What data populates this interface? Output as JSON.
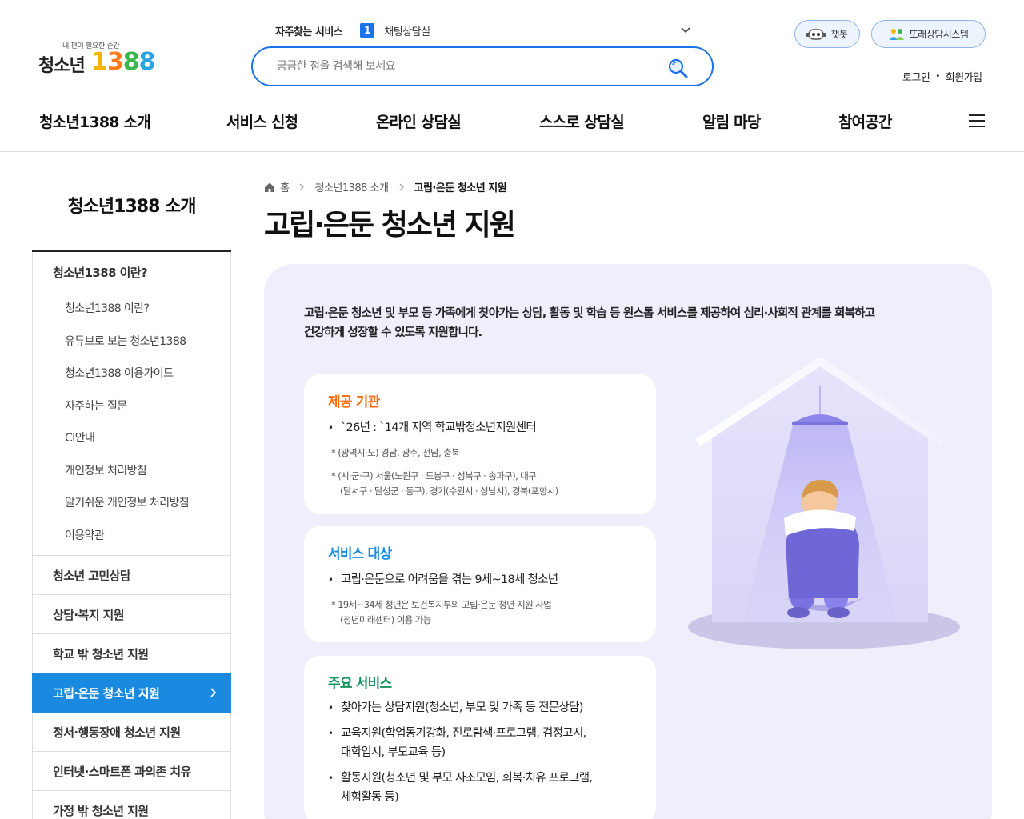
{
  "header": {
    "logo": {
      "tagline": "내 편이 필요한 순간",
      "name": "청소년",
      "number": "1388"
    },
    "favorites": {
      "label": "자주찾는 서비스",
      "rank": "1",
      "item": "채팅상담실"
    },
    "search": {
      "placeholder": "궁금한 점을 검색해 보세요"
    },
    "buttons": {
      "chatbot": "챗봇",
      "peer": "또래상담시스템"
    },
    "auth": {
      "login": "로그인",
      "separator": "•",
      "join": "회원가입"
    },
    "gnb": [
      "청소년1388 소개",
      "서비스 신청",
      "온라인 상담실",
      "스스로 상담실",
      "알림 마당",
      "참여공간"
    ]
  },
  "sidebar": {
    "title": "청소년1388 소개",
    "groups": [
      {
        "label": "청소년1388 이란?",
        "children": [
          "청소년1388 이란?",
          "유튜브로 보는 청소년1388",
          "청소년1388 이용가이드",
          "자주하는 질문",
          "CI안내",
          "개인정보 처리방침",
          "알기쉬운 개인정보 처리방침",
          "이용약관"
        ]
      },
      {
        "label": "청소년 고민상담"
      },
      {
        "label": "상담·복지 지원"
      },
      {
        "label": "학교 밖 청소년 지원"
      },
      {
        "label": "고립·은둔 청소년 지원",
        "active": true
      },
      {
        "label": "정서·행동장애 청소년 지원"
      },
      {
        "label": "인터넷·스마트폰 과의존 치유"
      },
      {
        "label": "가정 밖 청소년 지원"
      }
    ]
  },
  "breadcrumb": {
    "home": "홈",
    "parent": "청소년1388 소개",
    "current": "고립·은둔 청소년 지원"
  },
  "page": {
    "title": "고립·은둔 청소년 지원",
    "intro_line1": "고립·은둔 청소년 및 부모 등 가족에게 찾아가는 상담, 활동 및 학습 등 원스톱 서비스를 제공하여 심리·사회적 관계를 회복하고",
    "intro_line2": "건강하게 성장할 수 있도록 지원합니다.",
    "cards": {
      "provider": {
        "title": "제공 기관",
        "bullet": "`26년 : `14개 지역 학교밖청소년지원센터",
        "note1": "* (광역시·도) 경남, 광주, 전남, 충북",
        "note2a": "* (시·군·구) 서울(노원구 · 도봉구 · 성북구 · 송파구), 대구",
        "note2b": "(달서구 · 달성군 · 동구), 경기(수원시 · 성남시), 경북(포항시)"
      },
      "target": {
        "title": "서비스 대상",
        "bullet": "고립·은둔으로 어려움을 겪는 9세~18세 청소년",
        "note_a": "* 19세~34세 청년은 보건복지부의 고립·은둔 청년 지원 사업",
        "note_b": "(청년미래센터) 이용 가능"
      },
      "services": {
        "title": "주요 서비스",
        "b1": "찾아가는 상담지원(청소년, 부모 및 가족 등 전문상담)",
        "b2a": "교육지원(학업동기강화, 진로탐색·프로그램, 검정고시,",
        "b2b": "대학입시, 부모교육 등)",
        "b3a": "활동지원(청소년 및 부모 자조모임, 회복·치유 프로그램,",
        "b3b": "체험활동 등)"
      }
    }
  },
  "colors": {
    "primary": "#1a73e8",
    "active_menu": "#1a8ae0",
    "panel_bg": "#efeffc",
    "provider_title": "#ff6a13",
    "target_title": "#1a8ae0",
    "services_title": "#14935a"
  },
  "icons": {
    "search": "search-icon",
    "chevron": "chevron-down-icon",
    "menu": "hamburger-icon",
    "home": "home-icon",
    "chatbot": "robot-icon",
    "peer": "people-icon"
  }
}
